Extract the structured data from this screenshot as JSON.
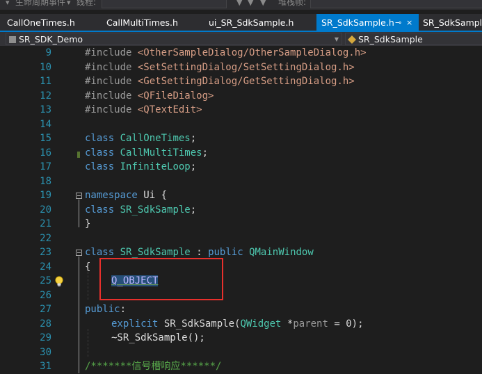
{
  "toolbar": {
    "item1": "生命周期事件",
    "item2": "线程:",
    "item3": "堆栈帧:"
  },
  "tabs": [
    {
      "label": "CallOneTimes.h",
      "active": false
    },
    {
      "label": "CallMultiTimes.h",
      "active": false
    },
    {
      "label": "ui_SR_SdkSample.h",
      "active": false
    },
    {
      "label": "SR_SdkSample.h",
      "active": true
    },
    {
      "label": "SR_SdkSample",
      "active": false
    }
  ],
  "tab_pin_icon": "⊸",
  "tab_close_icon": "×",
  "nav": {
    "project": "SR_SDK_Demo",
    "scope": "SR_SdkSample"
  },
  "lines": [
    9,
    10,
    11,
    12,
    13,
    14,
    15,
    16,
    17,
    18,
    19,
    20,
    21,
    22,
    23,
    24,
    25,
    26,
    27,
    28,
    29,
    30,
    31
  ],
  "code": {
    "l9": {
      "kw": "#include",
      "path": "<OtherSampleDialog/OtherSampleDialog.h>"
    },
    "l10": {
      "kw": "#include",
      "path": "<SetSettingDialog/SetSettingDialog.h>"
    },
    "l11": {
      "kw": "#include",
      "path": "<GetSettingDialog/GetSettingDialog.h>"
    },
    "l12": {
      "kw": "#include",
      "path": "<QFileDialog>"
    },
    "l13": {
      "kw": "#include",
      "path": "<QTextEdit>"
    },
    "l15": {
      "kw": "class",
      "name": "CallOneTimes",
      "end": ";"
    },
    "l16": {
      "kw": "class",
      "name": "CallMultiTimes",
      "end": ";"
    },
    "l17": {
      "kw": "class",
      "name": "InfiniteLoop",
      "end": ";"
    },
    "l19": {
      "kw": "namespace",
      "name": "Ui",
      "end": "{"
    },
    "l20": {
      "kw": "class",
      "name": "SR_SdkSample",
      "end": ";"
    },
    "l21": {
      "text": "}"
    },
    "l23": {
      "kw": "class",
      "name": "SR_SdkSample",
      "sep": ":",
      "kw2": "public",
      "base": "QMainWindow"
    },
    "l24": {
      "text": "{"
    },
    "l25": {
      "macro": "Q_OBJECT"
    },
    "l27": {
      "kw": "public",
      "end": ":"
    },
    "l28": {
      "kw": "explicit",
      "fn": "SR_SdkSample(",
      "type": "QWidget",
      "rest": "*",
      "param": "parent",
      "tail": "= 0);"
    },
    "l29": {
      "text": "~SR_SdkSample();"
    },
    "l31": {
      "comment": "/*******信号槽响应******/"
    }
  },
  "colors": {
    "accent": "#007acc",
    "highlight_box": "#e8302c",
    "keyword": "#569cd6",
    "type": "#4ec9b0",
    "string": "#d69d85"
  }
}
